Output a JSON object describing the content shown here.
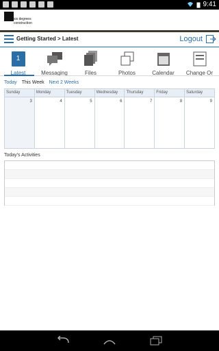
{
  "status": {
    "time": "9:41"
  },
  "logo": {
    "line1": "six degrees",
    "line2": "construction"
  },
  "nav": {
    "breadcrumb": "Getting Started > Latest",
    "logout_label": "Logout"
  },
  "tabs": [
    {
      "label": "Latest",
      "icon": "calendar-day-icon",
      "day": "1",
      "active": true
    },
    {
      "label": "Messaging",
      "icon": "chat-icon"
    },
    {
      "label": "Files",
      "icon": "files-icon"
    },
    {
      "label": "Photos",
      "icon": "photos-icon"
    },
    {
      "label": "Calendar",
      "icon": "calendar-icon"
    },
    {
      "label": "Change Or",
      "icon": "change-order-icon"
    }
  ],
  "filters": {
    "today": "Today",
    "this_week": "This Week",
    "next_2_weeks": "Next 2 Weeks"
  },
  "calendar": {
    "days": [
      "Sunday",
      "Monday",
      "Tuesday",
      "Wednesday",
      "Thursday",
      "Friday",
      "Saturday"
    ],
    "dates": [
      "3",
      "4",
      "5",
      "6",
      "7",
      "8",
      "9"
    ]
  },
  "activities": {
    "label": "Today's Activities"
  },
  "colors": {
    "accent": "#2a6ea8"
  }
}
